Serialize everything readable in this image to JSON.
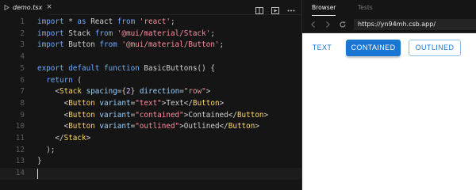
{
  "editor": {
    "tab": {
      "file_name": "demo.tsx",
      "close_glyph": "×",
      "icon": "typescript-file-icon"
    },
    "actions": [
      "split-editor-icon",
      "preview-icon",
      "more-icon"
    ],
    "lines": [
      {
        "n": "1",
        "segments": [
          [
            "kw",
            "import"
          ],
          [
            "p",
            " * "
          ],
          [
            "kw",
            "as"
          ],
          [
            "p",
            " React "
          ],
          [
            "kw",
            "from"
          ],
          [
            "p",
            " "
          ],
          [
            "str",
            "'react'"
          ],
          [
            "p",
            ";"
          ]
        ]
      },
      {
        "n": "2",
        "segments": [
          [
            "kw",
            "import"
          ],
          [
            "p",
            " Stack "
          ],
          [
            "kw",
            "from"
          ],
          [
            "p",
            " "
          ],
          [
            "str",
            "'@mui/material/Stack'"
          ],
          [
            "p",
            ";"
          ]
        ]
      },
      {
        "n": "3",
        "segments": [
          [
            "kw",
            "import"
          ],
          [
            "p",
            " Button "
          ],
          [
            "kw",
            "from"
          ],
          [
            "p",
            " "
          ],
          [
            "str",
            "'@mui/material/Button'"
          ],
          [
            "p",
            ";"
          ]
        ]
      },
      {
        "n": "4",
        "segments": []
      },
      {
        "n": "5",
        "segments": [
          [
            "kw",
            "export"
          ],
          [
            "p",
            " "
          ],
          [
            "kw",
            "default"
          ],
          [
            "p",
            " "
          ],
          [
            "kw",
            "function"
          ],
          [
            "p",
            " BasicButtons() {"
          ]
        ]
      },
      {
        "n": "6",
        "segments": [
          [
            "p",
            "  "
          ],
          [
            "kw",
            "return"
          ],
          [
            "p",
            " ("
          ]
        ]
      },
      {
        "n": "7",
        "segments": [
          [
            "p",
            "    <"
          ],
          [
            "tag",
            "Stack"
          ],
          [
            "p",
            " "
          ],
          [
            "attr",
            "spacing"
          ],
          [
            "p",
            "={"
          ],
          [
            "num",
            "2"
          ],
          [
            "p",
            "} "
          ],
          [
            "attr",
            "direction"
          ],
          [
            "p",
            "="
          ],
          [
            "str",
            "\"row\""
          ],
          [
            "p",
            ">"
          ]
        ]
      },
      {
        "n": "8",
        "segments": [
          [
            "p",
            "      <"
          ],
          [
            "tag",
            "Button"
          ],
          [
            "p",
            " "
          ],
          [
            "attr",
            "variant"
          ],
          [
            "p",
            "="
          ],
          [
            "str",
            "\"text\""
          ],
          [
            "p",
            ">Text</"
          ],
          [
            "tag",
            "Button"
          ],
          [
            "p",
            ">"
          ]
        ]
      },
      {
        "n": "9",
        "segments": [
          [
            "p",
            "      <"
          ],
          [
            "tag",
            "Button"
          ],
          [
            "p",
            " "
          ],
          [
            "attr",
            "variant"
          ],
          [
            "p",
            "="
          ],
          [
            "str",
            "\"contained\""
          ],
          [
            "p",
            ">Contained</"
          ],
          [
            "tag",
            "Button"
          ],
          [
            "p",
            ">"
          ]
        ]
      },
      {
        "n": "10",
        "segments": [
          [
            "p",
            "      <"
          ],
          [
            "tag",
            "Button"
          ],
          [
            "p",
            " "
          ],
          [
            "attr",
            "variant"
          ],
          [
            "p",
            "="
          ],
          [
            "str",
            "\"outlined\""
          ],
          [
            "p",
            ">Outlined</"
          ],
          [
            "tag",
            "Button"
          ],
          [
            "p",
            ">"
          ]
        ]
      },
      {
        "n": "11",
        "segments": [
          [
            "p",
            "    </"
          ],
          [
            "tag",
            "Stack"
          ],
          [
            "p",
            ">"
          ]
        ]
      },
      {
        "n": "12",
        "segments": [
          [
            "p",
            "  );"
          ]
        ]
      },
      {
        "n": "13",
        "segments": [
          [
            "p",
            "}"
          ]
        ]
      },
      {
        "n": "14",
        "segments": [],
        "cursor": true
      }
    ]
  },
  "preview": {
    "tabs": [
      {
        "label": "Browser",
        "active": true
      },
      {
        "label": "Tests",
        "active": false
      }
    ],
    "url": "https://yn94mh.csb.app/",
    "nav_icons": [
      "back-arrow-icon",
      "forward-arrow-icon",
      "reload-icon"
    ],
    "buttons": {
      "text": "TEXT",
      "contained": "CONTAINED",
      "outlined": "OUTLINED"
    }
  },
  "colors": {
    "accent": "#1976d2",
    "editor_bg": "#151515",
    "preview_bg": "#ffffff"
  }
}
